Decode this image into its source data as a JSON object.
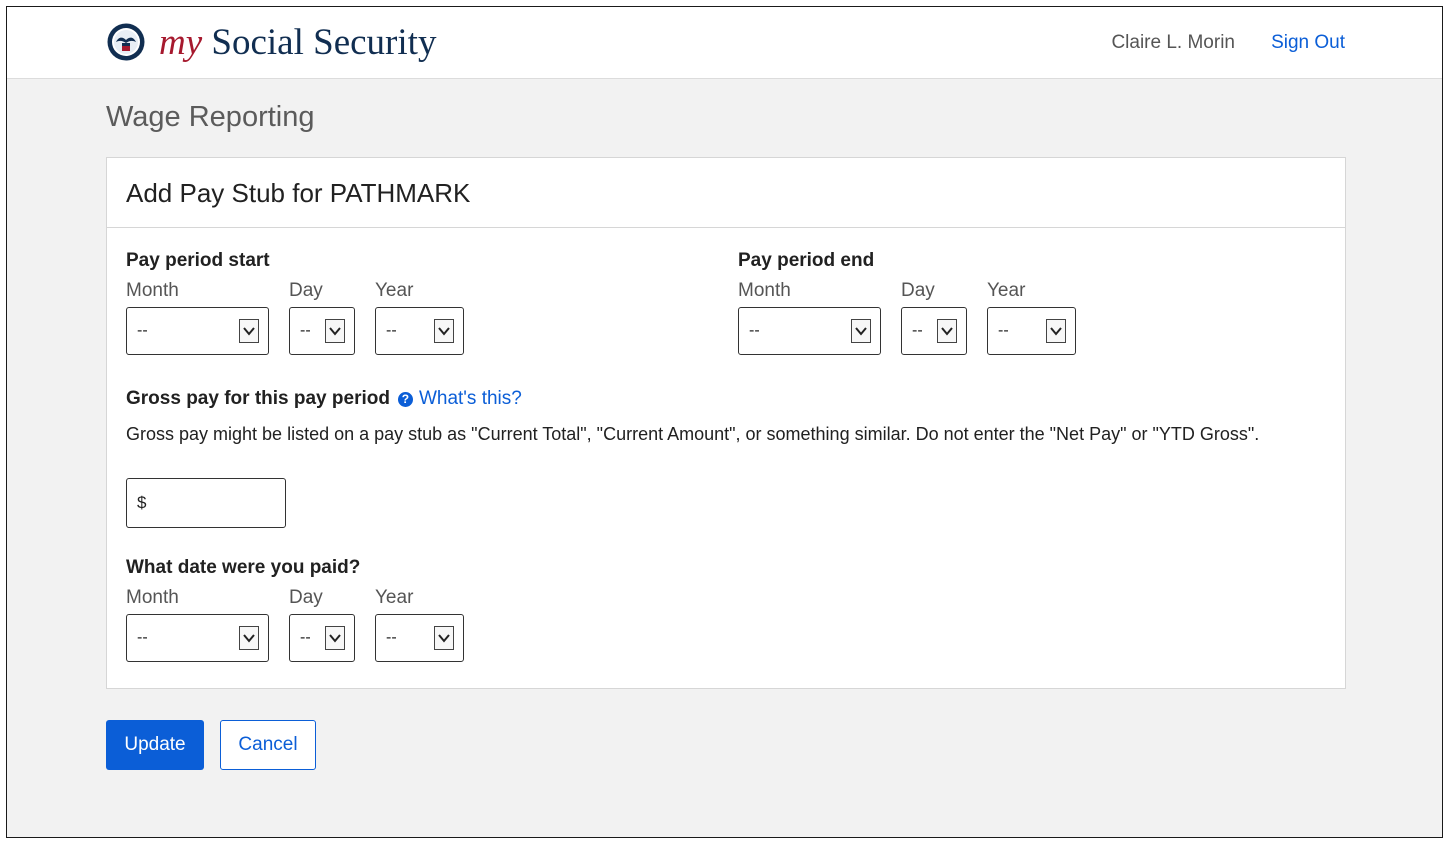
{
  "header": {
    "brand_my": "my",
    "brand_rest": " Social Security",
    "user_name": "Claire L. Morin",
    "sign_out": "Sign Out"
  },
  "page": {
    "title": "Wage Reporting"
  },
  "form": {
    "title": "Add Pay Stub for PATHMARK",
    "pay_period_start": {
      "label": "Pay period start",
      "month_label": "Month",
      "day_label": "Day",
      "year_label": "Year",
      "month_value": "--",
      "day_value": "--",
      "year_value": "--"
    },
    "pay_period_end": {
      "label": "Pay period end",
      "month_label": "Month",
      "day_label": "Day",
      "year_label": "Year",
      "month_value": "--",
      "day_value": "--",
      "year_value": "--"
    },
    "gross_pay": {
      "label": "Gross pay for this pay period",
      "help_link": "What's this?",
      "help_text": "Gross pay might be listed on a pay stub as \"Current Total\", \"Current Amount\", or something similar. Do not enter the \"Net Pay\" or \"YTD Gross\".",
      "currency_symbol": "$",
      "value": ""
    },
    "paid_date": {
      "label": "What date were you paid?",
      "month_label": "Month",
      "day_label": "Day",
      "year_label": "Year",
      "month_value": "--",
      "day_value": "--",
      "year_value": "--"
    }
  },
  "actions": {
    "update": "Update",
    "cancel": "Cancel"
  },
  "colors": {
    "link_blue": "#0b5ed7",
    "brand_red": "#a6192e",
    "brand_navy": "#112e51"
  }
}
